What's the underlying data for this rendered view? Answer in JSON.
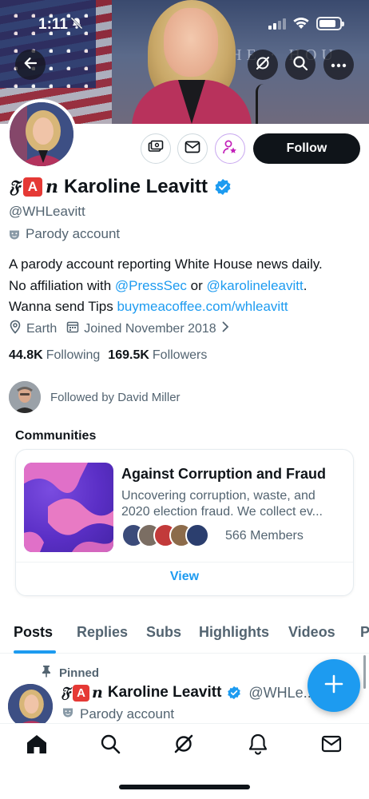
{
  "status_bar": {
    "time": "1:11"
  },
  "profile": {
    "display_prefix": "𝔉",
    "display_letter": "A",
    "display_suffix": "n",
    "display_name": "Karoline Leavitt",
    "handle": "@WHLeavitt",
    "parody_label": "Parody account",
    "follow_label": "Follow",
    "bio_line1": "A parody account reporting White House news daily.",
    "bio_line2_pre": "No affiliation with ",
    "bio_mention1": "@PressSec",
    "bio_line2_mid": " or ",
    "bio_mention2": "@karolineleavitt",
    "bio_line2_post": ".",
    "bio_line3_pre": "Wanna send Tips ",
    "bio_link": "buymeacoffee.com/whleavitt",
    "location": "Earth",
    "joined": "Joined November 2018",
    "following_count": "44.8K",
    "following_label": "Following",
    "followers_count": "169.5K",
    "followers_label": "Followers",
    "followed_by": "Followed by David Miller"
  },
  "communities": {
    "title": "Communities",
    "card": {
      "name": "Against Corruption and Fraud",
      "description_line1": "Uncovering corruption, waste, and",
      "description_line2": "2020 election fraud. We collect ev...",
      "members": "566 Members",
      "view_label": "View"
    }
  },
  "tabs": [
    "Posts",
    "Replies",
    "Subs",
    "Highlights",
    "Videos",
    "P"
  ],
  "pinned_post": {
    "pinned_label": "Pinned",
    "display_name": "Karoline Leavitt",
    "handle": "@WHLe...",
    "parody_label": "Parody account"
  },
  "colors": {
    "accent": "#1d9bf0",
    "text": "#0f1419",
    "muted": "#536471"
  }
}
